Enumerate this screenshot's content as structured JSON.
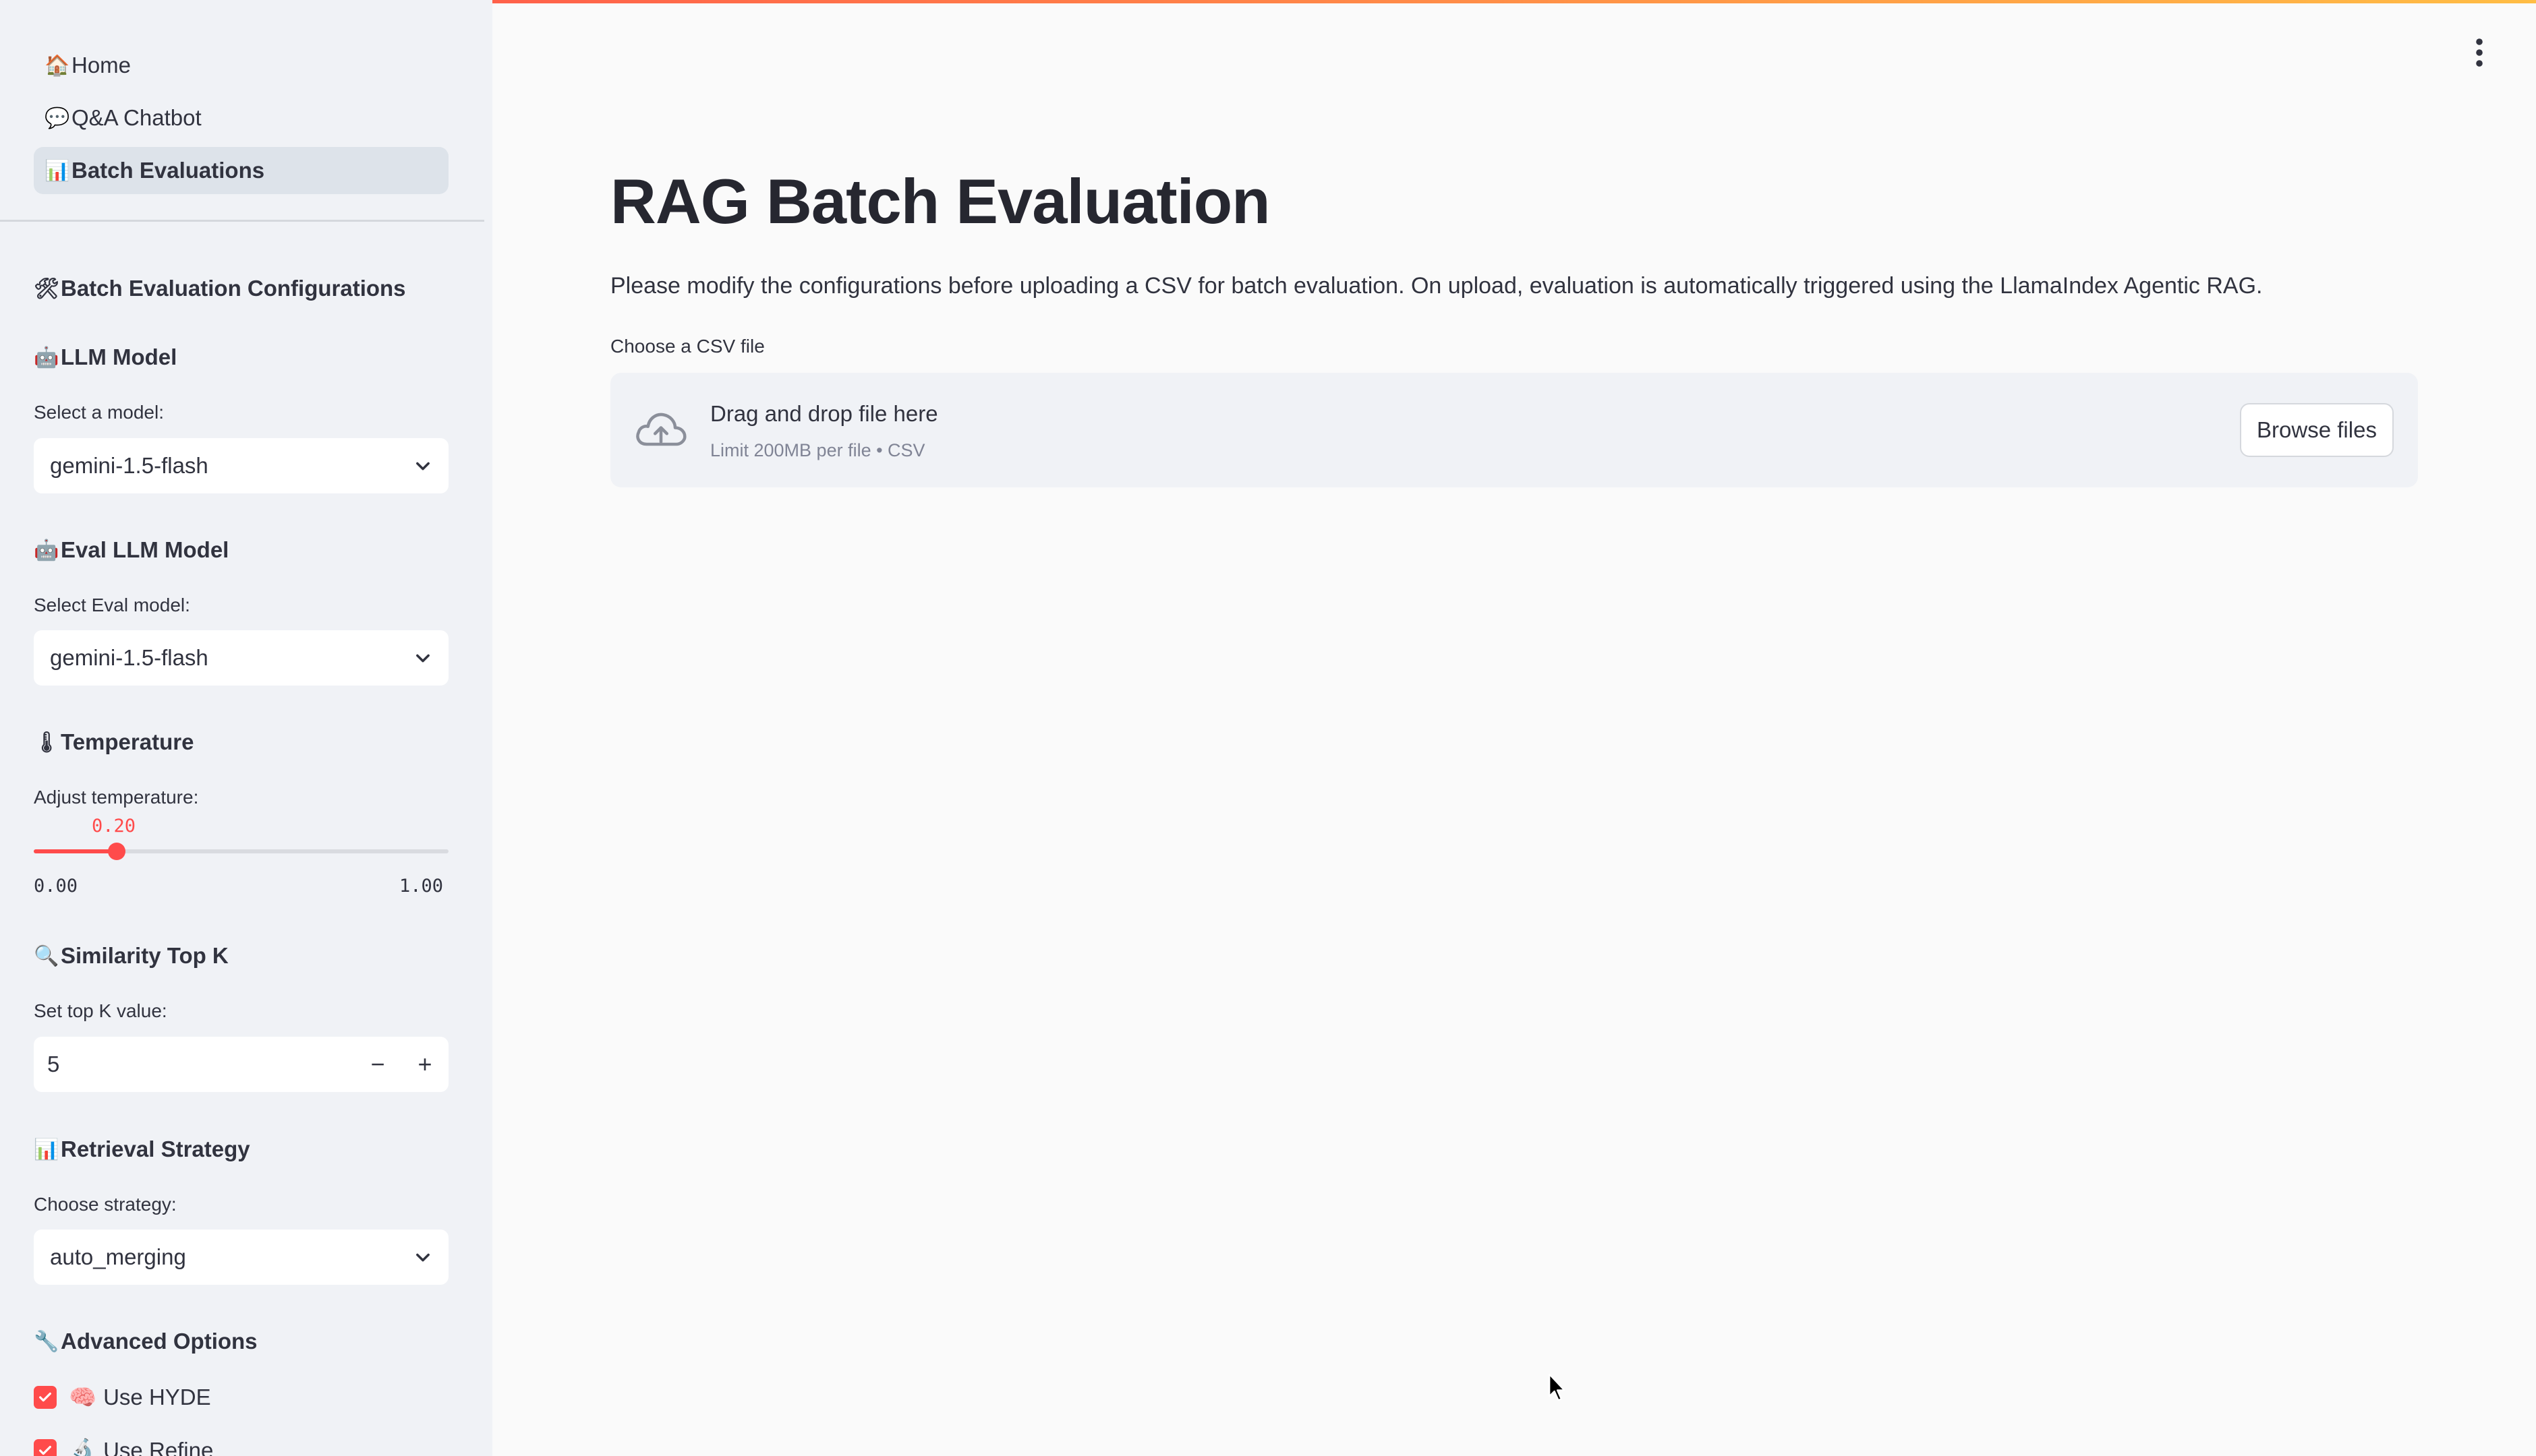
{
  "nav": {
    "items": [
      {
        "icon": "home-icon",
        "glyph": "🏠",
        "label": "Home"
      },
      {
        "icon": "chat-icon",
        "glyph": "💬",
        "label": "Q&A Chatbot"
      },
      {
        "icon": "chart-icon",
        "glyph": "📊",
        "label": "Batch Evaluations"
      }
    ],
    "active": "Batch Evaluations"
  },
  "sidebar": {
    "config_title": "Batch Evaluation Configurations",
    "llm": {
      "title": "LLM Model",
      "label": "Select a model:",
      "value": "gemini-1.5-flash"
    },
    "eval_llm": {
      "title": "Eval LLM Model",
      "label": "Select Eval model:",
      "value": "gemini-1.5-flash"
    },
    "temperature": {
      "title": "Temperature",
      "label": "Adjust temperature:",
      "value": "0.20",
      "value_num": 0.2,
      "min": "0.00",
      "max": "1.00"
    },
    "topk": {
      "title": "Similarity Top K",
      "label": "Set top K value:",
      "value": "5",
      "minus": "−",
      "plus": "+"
    },
    "strategy": {
      "title": "Retrieval Strategy",
      "label": "Choose strategy:",
      "value": "auto_merging"
    },
    "advanced": {
      "title": "Advanced Options",
      "use_hyde": "Use HYDE",
      "use_refine": "Use Refine"
    }
  },
  "main": {
    "title": "RAG Batch Evaluation",
    "description": "Please modify the configurations before uploading a CSV for batch evaluation. On upload, evaluation is automatically triggered using the LlamaIndex Agentic RAG.",
    "file_label": "Choose a CSV file",
    "dropzone": {
      "title": "Drag and drop file here",
      "subtitle": "Limit 200MB per file • CSV",
      "button": "Browse files"
    }
  },
  "colors": {
    "accent": "#ff4b4b",
    "sidebar_bg": "#f0f2f6",
    "main_bg": "#fafafa"
  }
}
